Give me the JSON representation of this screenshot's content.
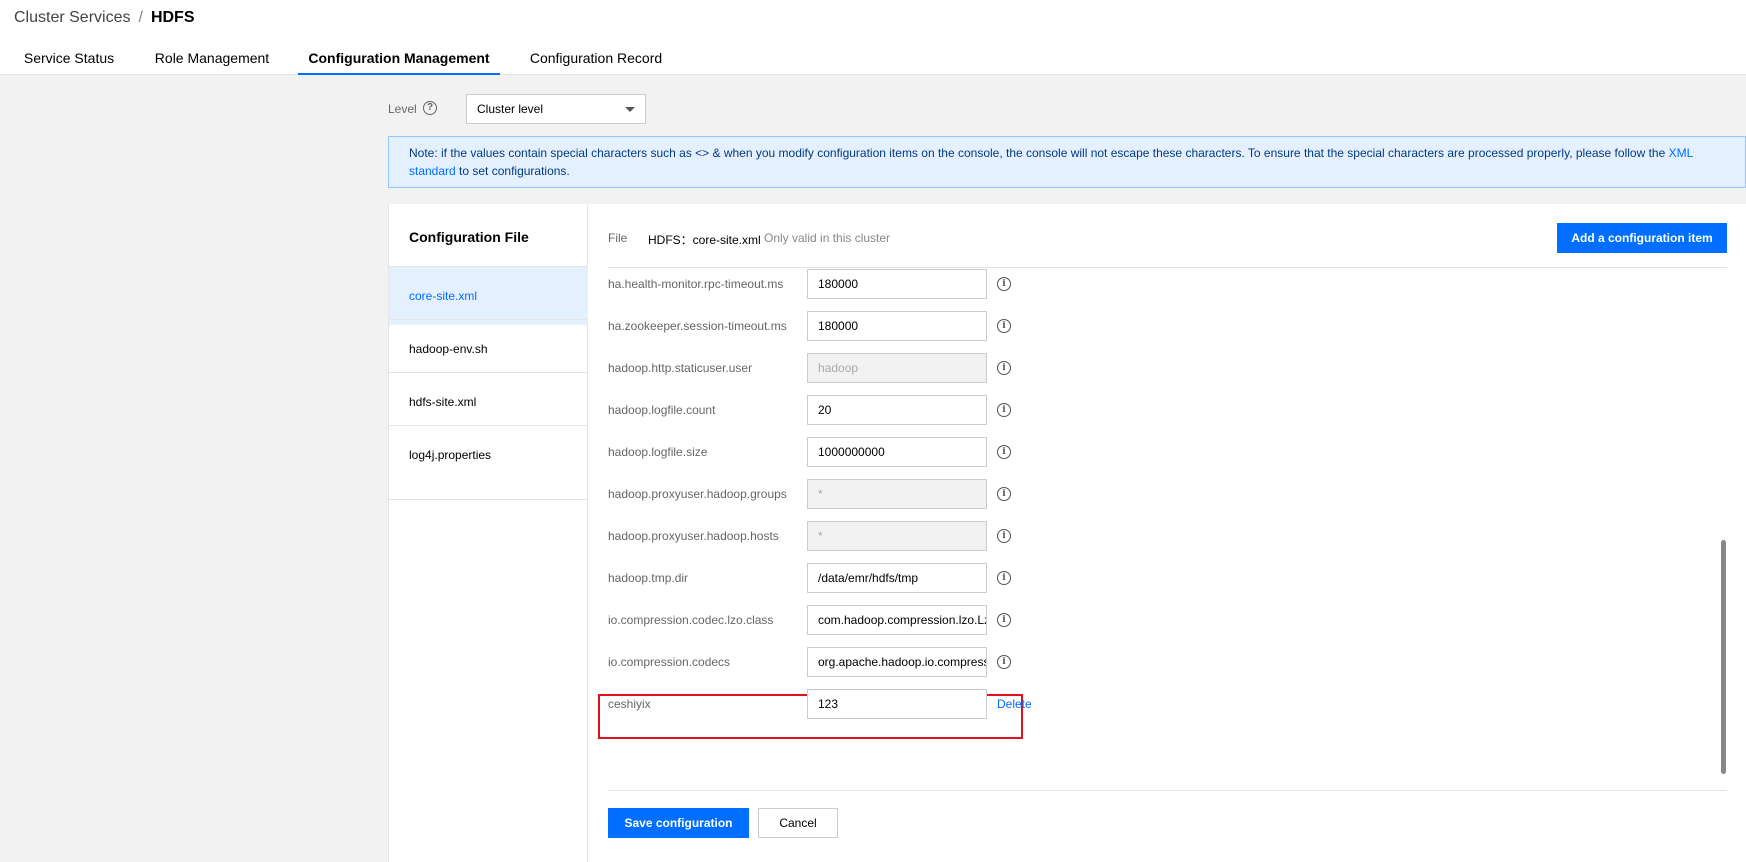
{
  "breadcrumb": {
    "parent": "Cluster Services",
    "separator": "/",
    "current": "HDFS"
  },
  "tabs": [
    {
      "label": "Service Status"
    },
    {
      "label": "Role Management"
    },
    {
      "label": "Configuration Management"
    },
    {
      "label": "Configuration Record"
    }
  ],
  "level": {
    "label": "Level",
    "help": "?",
    "selected": "Cluster level"
  },
  "note": {
    "text": "Note: if the values contain special characters such as <> & when you modify configuration items on the console, the console will not escape these characters. To ensure that the special characters are processed properly, please follow the ",
    "link1": "XML",
    "link2": "standard",
    "suffix": " to set configurations."
  },
  "sidebar": {
    "title": "Configuration File",
    "files": [
      {
        "label": "core-site.xml"
      },
      {
        "label": "hadoop-env.sh"
      },
      {
        "label": "hdfs-site.xml"
      },
      {
        "label": "log4j.properties"
      }
    ]
  },
  "file_header": {
    "label": "File",
    "name": "HDFS：core-site.xml",
    "note": "Only valid in this cluster",
    "add_button": "Add a configuration item"
  },
  "config_items": [
    {
      "key": "ha.health-monitor.rpc-timeout.ms",
      "value": "180000"
    },
    {
      "key": "ha.zookeeper.session-timeout.ms",
      "value": "180000"
    },
    {
      "key": "hadoop.http.staticuser.user",
      "value": "hadoop"
    },
    {
      "key": "hadoop.logfile.count",
      "value": "20"
    },
    {
      "key": "hadoop.logfile.size",
      "value": "1000000000"
    },
    {
      "key": "hadoop.proxyuser.hadoop.groups",
      "value": "*"
    },
    {
      "key": "hadoop.proxyuser.hadoop.hosts",
      "value": "*"
    },
    {
      "key": "hadoop.tmp.dir",
      "value": "/data/emr/hdfs/tmp"
    },
    {
      "key": "io.compression.codec.lzo.class",
      "value": "com.hadoop.compression.lzo.LzoCodec"
    },
    {
      "key": "io.compression.codecs",
      "value": "org.apache.hadoop.io.compress.GzipCodec"
    },
    {
      "key": "ceshiyix",
      "value": "123",
      "action": "Delete"
    }
  ],
  "footer": {
    "save": "Save configuration",
    "cancel": "Cancel"
  },
  "colors": {
    "accent": "#006eff",
    "highlight": "#e0101e",
    "background": "#f2f2f2"
  }
}
